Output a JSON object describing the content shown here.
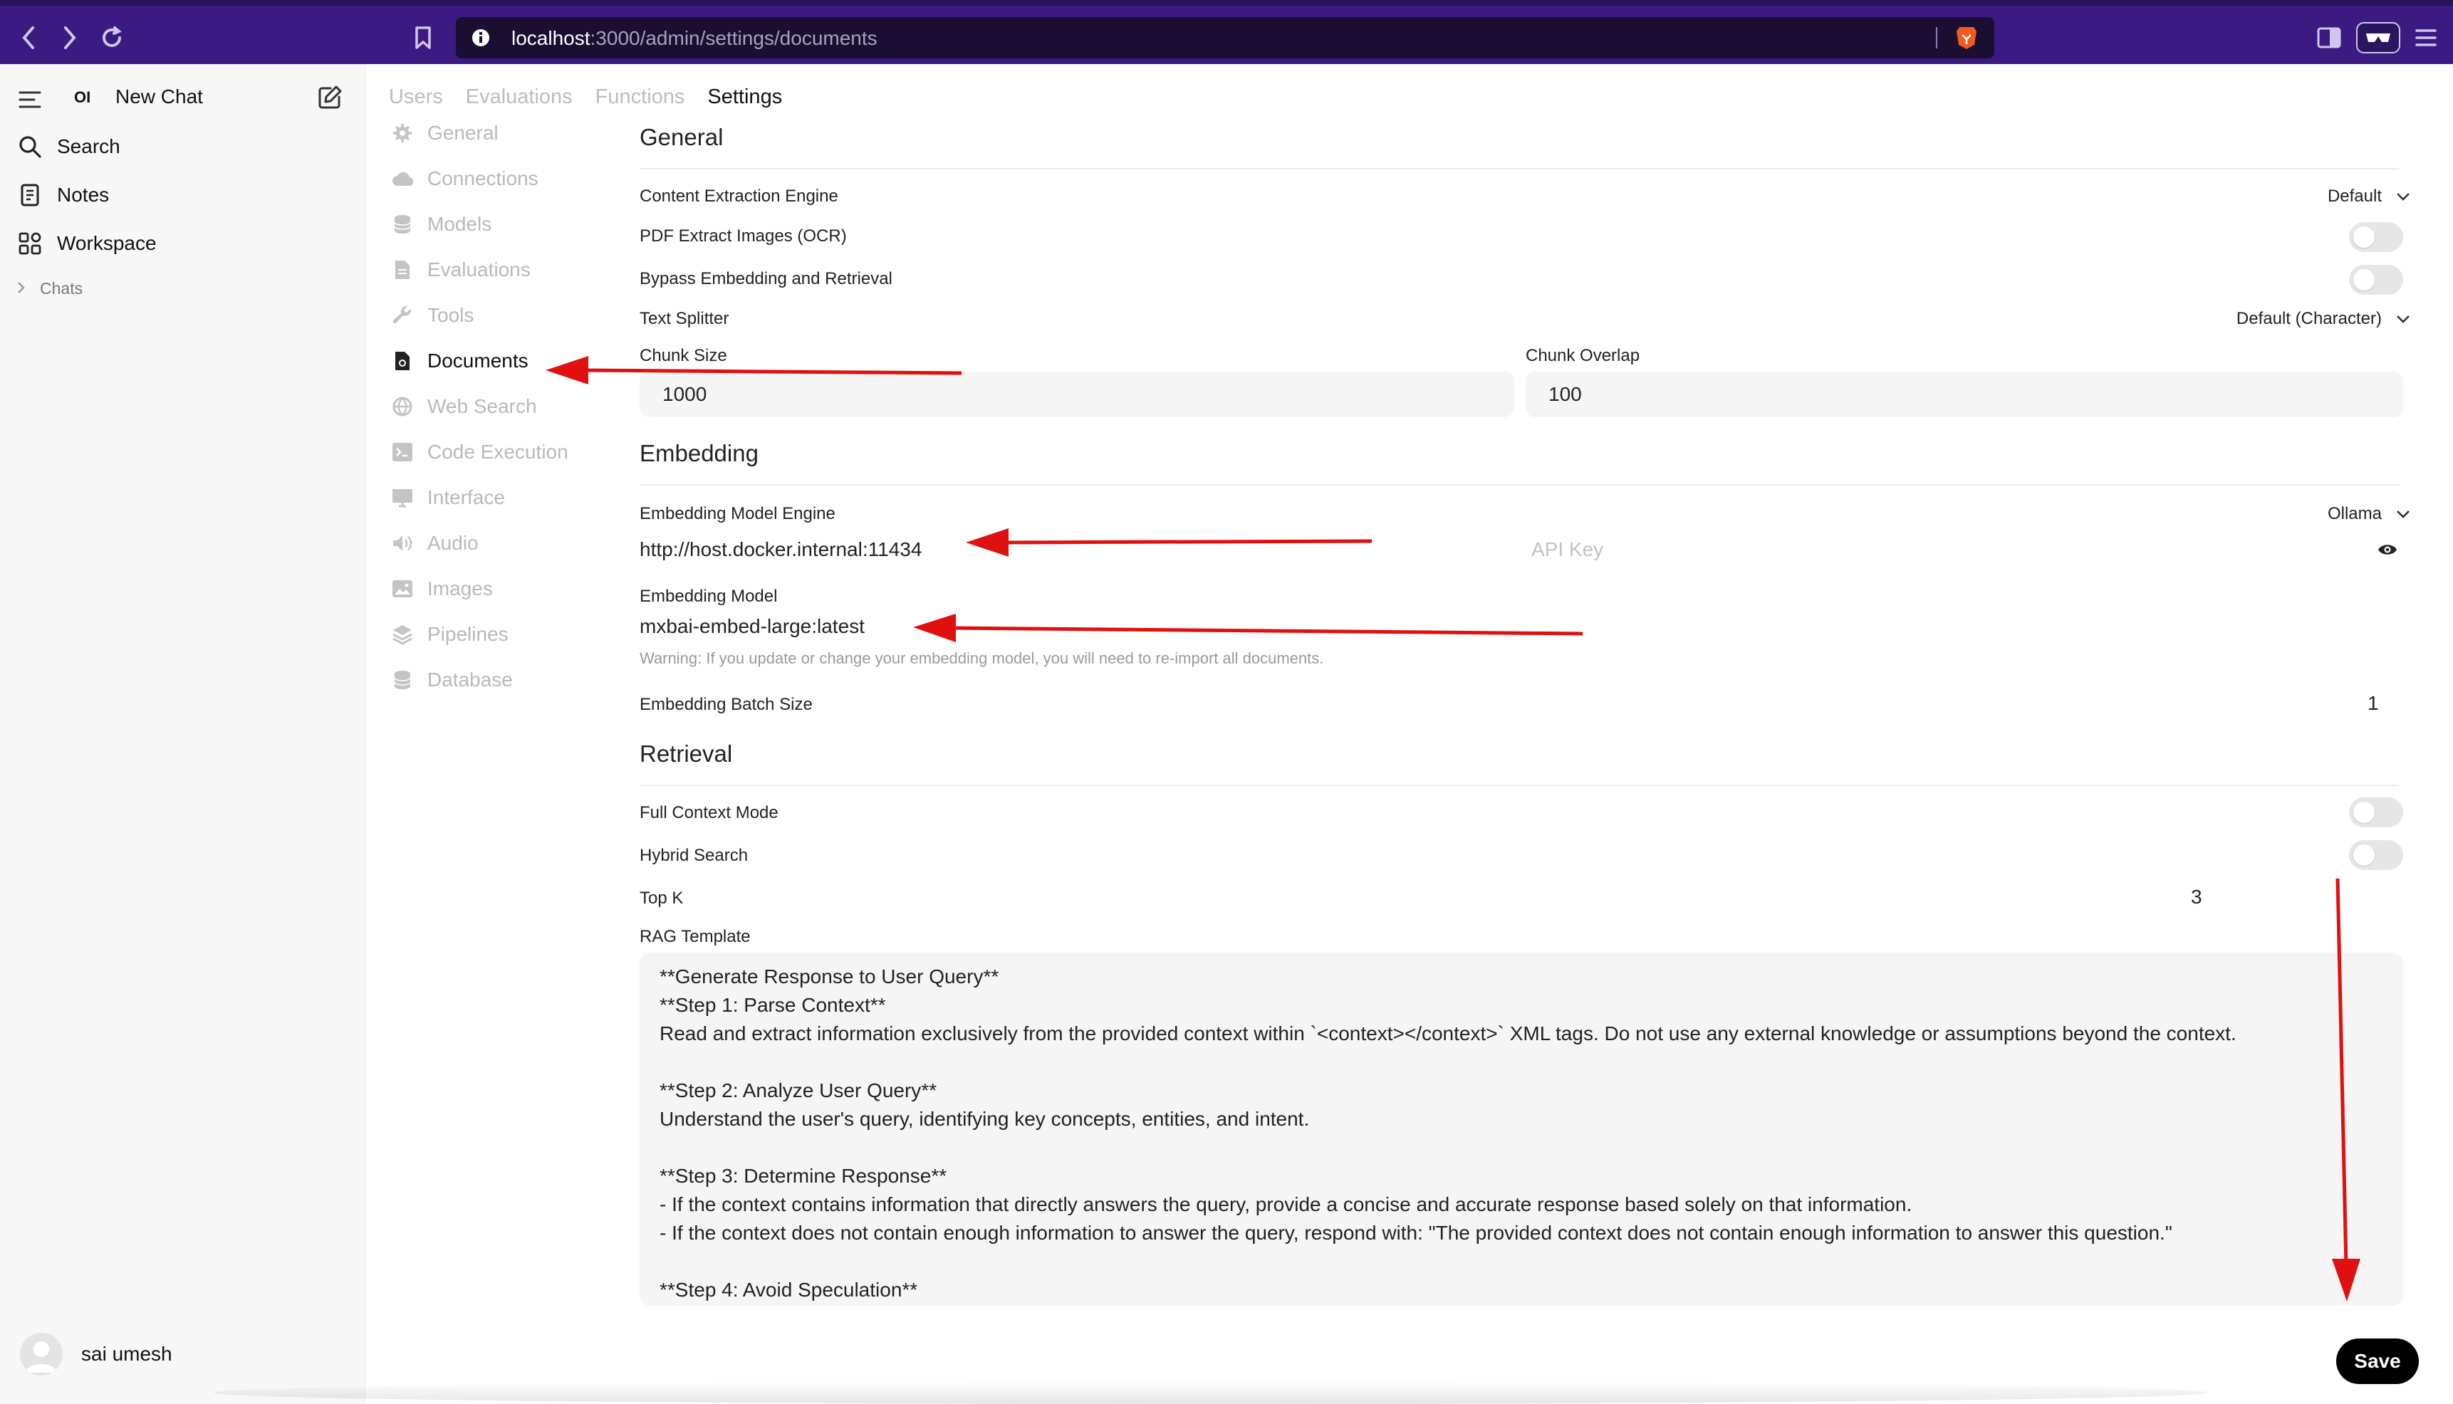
{
  "browser": {
    "url_host": "localhost",
    "url_path": ":3000/admin/settings/documents"
  },
  "sidebar": {
    "logo": "OI",
    "new_chat": "New Chat",
    "items": [
      {
        "label": "Search",
        "icon": "search-icon"
      },
      {
        "label": "Notes",
        "icon": "notes-icon"
      },
      {
        "label": "Workspace",
        "icon": "workspace-icon"
      }
    ],
    "chats_label": "Chats",
    "user_name": "sai umesh"
  },
  "top_tabs": [
    "Users",
    "Evaluations",
    "Functions",
    "Settings"
  ],
  "active_tab": "Settings",
  "settings_nav": [
    {
      "label": "General",
      "icon": "gear-icon"
    },
    {
      "label": "Connections",
      "icon": "cloud-icon"
    },
    {
      "label": "Models",
      "icon": "database-icon"
    },
    {
      "label": "Evaluations",
      "icon": "document-icon"
    },
    {
      "label": "Tools",
      "icon": "wrench-icon"
    },
    {
      "label": "Documents",
      "icon": "document-icon"
    },
    {
      "label": "Web Search",
      "icon": "globe-icon"
    },
    {
      "label": "Code Execution",
      "icon": "terminal-icon"
    },
    {
      "label": "Interface",
      "icon": "monitor-icon"
    },
    {
      "label": "Audio",
      "icon": "speaker-icon"
    },
    {
      "label": "Images",
      "icon": "image-icon"
    },
    {
      "label": "Pipelines",
      "icon": "layers-icon"
    },
    {
      "label": "Database",
      "icon": "database-icon"
    }
  ],
  "active_nav": "Documents",
  "general": {
    "title": "General",
    "content_extraction_label": "Content Extraction Engine",
    "content_extraction_value": "Default",
    "pdf_ocr_label": "PDF Extract Images (OCR)",
    "pdf_ocr_on": false,
    "bypass_label": "Bypass Embedding and Retrieval",
    "bypass_on": false,
    "text_splitter_label": "Text Splitter",
    "text_splitter_value": "Default (Character)",
    "chunk_size_label": "Chunk Size",
    "chunk_size_value": "1000",
    "chunk_overlap_label": "Chunk Overlap",
    "chunk_overlap_value": "100"
  },
  "embedding": {
    "title": "Embedding",
    "engine_label": "Embedding Model Engine",
    "engine_value": "Ollama",
    "url_value": "http://host.docker.internal:11434",
    "api_key_placeholder": "API Key",
    "model_label": "Embedding Model",
    "model_value": "mxbai-embed-large:latest",
    "warning": "Warning: If you update or change your embedding model, you will need to re-import all documents.",
    "batch_label": "Embedding Batch Size",
    "batch_value": "1"
  },
  "retrieval": {
    "title": "Retrieval",
    "full_context_label": "Full Context Mode",
    "full_context_on": false,
    "hybrid_label": "Hybrid Search",
    "hybrid_on": false,
    "top_k_label": "Top K",
    "top_k_value": "3",
    "rag_template_label": "RAG Template",
    "rag_template_lines": [
      "**Generate Response to User Query**",
      "**Step 1: Parse Context**",
      "Read and extract information exclusively from the provided context within `<context></context>` XML tags. Do not use any external knowledge or assumptions beyond the context.",
      "",
      "**Step 2: Analyze User Query**",
      "Understand the user's query, identifying key concepts, entities, and intent.",
      "",
      "**Step 3: Determine Response**",
      "- If the context contains information that directly answers the query, provide a concise and accurate response based solely on that information.",
      "- If the context does not contain enough information to answer the query, respond with: \"The provided context does not contain enough information to answer this question.\"",
      "",
      "**Step 4: Avoid Speculation**"
    ]
  },
  "save_label": "Save",
  "colors": {
    "chrome": "#3b1a82",
    "url_bar": "#1a0f33",
    "annotation_arrow": "#e01010",
    "brave_lion": "#f25b1d"
  }
}
